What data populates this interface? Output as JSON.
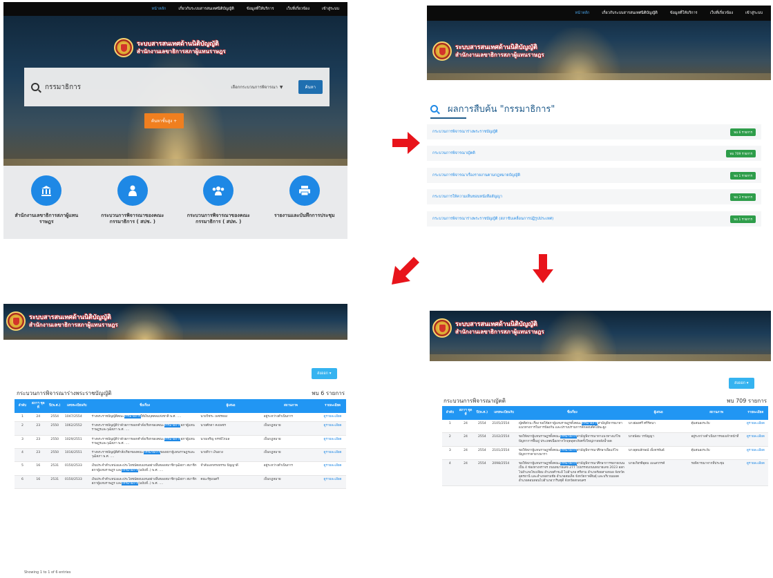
{
  "nav": {
    "items": [
      "หน้าหลัก",
      "เกี่ยวกับระบบสารสนเทศนิติบัญญัติ",
      "ข้อมูลที่ให้บริการ",
      "เว็บที่เกี่ยวข้อง",
      "เข้าสู่ระบบ"
    ]
  },
  "brand": {
    "line1": "ระบบสารสนเทศด้านนิติบัญญัติ",
    "line2": "สำนักงานเลขาธิการสภาผู้แทนราษฎร"
  },
  "home": {
    "search_value": "กรรมาธิการ",
    "process_select": "เลือกกระบวนการพิจารณา",
    "search_button": "ค้นหา",
    "advanced_button": "ค้นหาขั้นสูง +",
    "features": [
      {
        "icon": "building-icon",
        "label": "สำนักงานเลขาธิการสภาผู้แทนราษฎร"
      },
      {
        "icon": "person-icon",
        "label": "กระบวนการพิจารณาของคณะกรรมาธิการ ( สปช. )"
      },
      {
        "icon": "group-icon",
        "label": "กระบวนการพิจารณาของคณะกรรมาธิการ ( สปท. )"
      },
      {
        "icon": "printer-icon",
        "label": "รายงานและบันทึกการประชุม"
      }
    ]
  },
  "results": {
    "title": "ผลการสืบค้น \"กรรมาธิการ\"",
    "rows": [
      {
        "label": "กระบวนการพิจารณาร่างพระราชบัญญัติ",
        "badge": "พบ 6 รายการ"
      },
      {
        "label": "กระบวนการพิจารณาญัตติ",
        "badge": "พบ 709 รายการ"
      },
      {
        "label": "กระบวนการพิจารณาเรื่องรายงานตามกฎหมายบัญญัติ",
        "badge": "พบ 1 รายการ"
      },
      {
        "label": "กระบวนการให้ความเห็นชอบหนังสือสัญญา",
        "badge": "พบ 3 รายการ"
      },
      {
        "label": "กระบวนการพิจารณาร่างพระราชบัญญัติ (สภาขับเคลื่อนการปฏิรูปประเทศ)",
        "badge": "พบ 1 รายการ"
      }
    ]
  },
  "bill_table": {
    "export": "ส่งออก ▾",
    "title": "กระบวนการพิจารณาร่างพระราชบัญญัติ",
    "count": "พบ 6 รายการ",
    "headers": [
      "ลำดับ",
      "สภาฯ ชุดที่",
      "ปี(พ.ศ.)",
      "เลขทะเบียนรับ",
      "ชื่อเรื่อง",
      "ผู้เสนอ",
      "สถานภาพ",
      "รายละเอียด"
    ],
    "rows": [
      {
        "no": "1",
        "session": "24",
        "year": "2554",
        "reg": "1047/2554",
        "pre": "ร่างพระราชบัญญัติคณะ",
        "hl": "กรรมาธิการ",
        "post": "ให้เงินบุคคลแห่งชาติ พ.ศ. ....",
        "proposer": "นายวิชระ เพชรทอง",
        "status": "อยู่ระหว่างดำเนินการ",
        "detail": "ดูรายละเอียด"
      },
      {
        "no": "2",
        "session": "23",
        "year": "2550",
        "reg": "1062/2552",
        "pre": "ร่างพระราชบัญญัติว่าด้วยการออกคำสั่งเรียกของคณะ",
        "hl": "กรรมาธิการ",
        "post": "สภาผู้แทนราษฎรและวุฒิสภา พ.ศ. ....",
        "proposer": "นายศักดา คงเพชร",
        "status": "เป็นกฎหมาย",
        "detail": "ดูรายละเอียด"
      },
      {
        "no": "3",
        "session": "23",
        "year": "2550",
        "reg": "1029/2551",
        "pre": "ร่างพระราชบัญญัติว่าด้วยการออกคำสั่งเรียกของคณะ",
        "hl": "กรรมาธิการ",
        "post": "สภาผู้แทนราษฎรและวุฒิสภา พ.ศ. ....",
        "proposer": "นายเจริญ จรรย์โกมล",
        "status": "เป็นกฎหมาย",
        "detail": "ดูรายละเอียด"
      },
      {
        "no": "4",
        "session": "23",
        "year": "2550",
        "reg": "1016/2551",
        "pre": "ร่างพระราชบัญญัติคำสั่งเรียกของคณะ",
        "hl": "กรรมาธิการ",
        "post": "ของสภาผู้แทนราษฎรและวุฒิสภา พ.ศ. ....",
        "proposer": "นายทิวา เงินยวง",
        "status": "เป็นกฎหมาย",
        "detail": "ดูรายละเอียด"
      },
      {
        "no": "5",
        "session": "16",
        "year": "2531",
        "reg": "0150/2533",
        "pre": "เงินประจำตำแหน่งและประโยชน์ตอบแทนอย่างอื่นของสมาชิกวุฒิสภา สมาชิกสภาผู้แทนราษฎร และ",
        "hl": "กรรมาธิการ",
        "post": "(ฉบับที่..) พ.ศ. ....",
        "proposer": "จำลับเอกทรงธรรม ปัญญาดี",
        "status": "อยู่ระหว่างดำเนินการ",
        "detail": "ดูรายละเอียด"
      },
      {
        "no": "6",
        "session": "16",
        "year": "2531",
        "reg": "0150/2533",
        "pre": "เงินประจำตำแหน่งและประโยชน์ตอบแทนอย่างอื่นของสมาชิกวุฒิสภา สมาชิกสภาผู้แทนราษฎร และ",
        "hl": "กรรมาธิการ",
        "post": "(ฉบับที่..) พ.ศ. ....",
        "proposer": "คณะรัฐมนตรี",
        "status": "เป็นกฎหมาย",
        "detail": "ดูรายละเอียด"
      }
    ],
    "footer": "Showing 1 to 1 of 6 entries"
  },
  "reso_table": {
    "export": "ส่งออก ▾",
    "title": "กระบวนการพิจารณาญัตติ",
    "count": "พบ 709 รายการ",
    "headers": [
      "ลำดับ",
      "สภาฯ ชุดที่",
      "ปี(พ.ศ.)",
      "เลขทะเบียนรับ",
      "ชื่อเรื่อง",
      "ผู้เสนอ",
      "สถานภาพ",
      "รายละเอียด"
    ],
    "rows": [
      {
        "no": "1",
        "session": "24",
        "year": "2554",
        "reg": "2105/2554",
        "pre": "ญัตติด่วน เรื่อง ขอให้สภาผู้แทนราษฎรตั้งคณะ",
        "hl": "กรรมาธิการ",
        "post": "สามัญพิจารณาหาแนวทางการในการป้องกัน และปราบปรามการลักลอบตัดไม้พะยูง",
        "proposer": "นางผ่องศรี ศรีรัตนา",
        "status": "ตุ้มสนองระงับ",
        "detail": "ดูรายละเอียด"
      },
      {
        "no": "2",
        "session": "24",
        "year": "2554",
        "reg": "2102/2554",
        "pre": "ขอให้สภาผู้แทนราษฎรตั้งคณะ",
        "hl": "กรรมาธิการ",
        "post": "สามัญพิจารณาหาแนวทางแก้ไขปัญหาการฟื้นฟู ประเทศเนื่องจากวิกฤตอุทกภัยครั้งใหญ่ภายหลังน้ำลด",
        "proposer": "นายน้อม วรปัญญา",
        "status": "อยู่ระหว่างดำเนินการของเจ้าหน้าที่",
        "detail": "ดูรายละเอียด"
      },
      {
        "no": "3",
        "session": "24",
        "year": "2554",
        "reg": "2101/2554",
        "pre": "ขอให้สภาผู้แทนราษฎรตั้งคณะ",
        "hl": "กรรมาธิการ",
        "post": "สามัญพิจารณาศึกษาเพื่อแก้ไขปัญหาราคายางพารา",
        "proposer": "นางอุดมลักษณ์ เพ็งจรพันธ์",
        "status": "ตุ้มสนองระงับ",
        "detail": "ดูรายละเอียด"
      },
      {
        "no": "4",
        "session": "24",
        "year": "2554",
        "reg": "2098/2554",
        "pre": "ขอให้สภาผู้แทนราษฎรตั้งคณะ",
        "hl": "กรรมาธิการ",
        "post": "สามัญพิจารณาศึกษาการขยายถนนเป็น 4 ช่องทางจราจร ถนนหมายเลข 277 ไปบรรจบถนนหมายเลข 2023 ออกไปอำเภอโขงเจียม อำเภอคำชะอี ไปอำเภอ ศรีสาม อำเภอร้อยสามหมอ จังหวัดอุดรธานี และอำเภอสามชัย อำเภอสมเด็จ จังหวัดกาฬสินธุ์ และบริเวณมอดอำเภอดอนทอนไปอำเภอวารินชุดี จังหวัดสกลนคร",
        "proposer": "นายเกียรติอุดม เมฆสวรรค์",
        "status": "รอพิจารณาจากที่ประชุม",
        "detail": "ดูรายละเอียด"
      }
    ]
  },
  "colors": {
    "nav_bg": "#0b0b0b",
    "accent_blue": "#1e88e5",
    "table_header": "#2196f3",
    "badge_green": "#2e9d4a",
    "advanced_orange": "#f07f1f",
    "arrow_red": "#e8141b"
  }
}
